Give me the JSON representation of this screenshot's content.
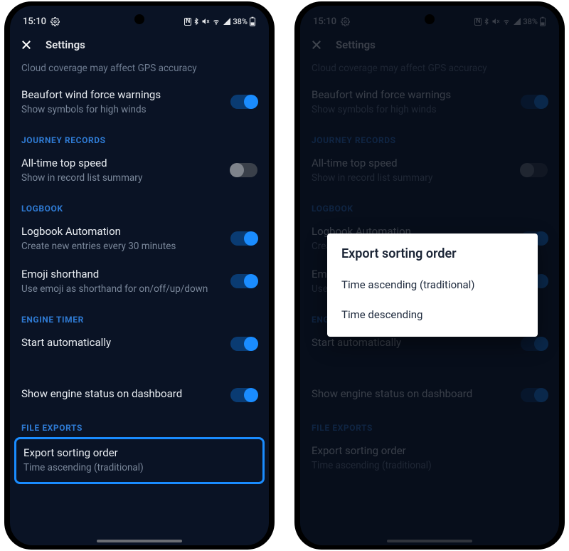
{
  "statusbar": {
    "time": "15:10",
    "battery_pct": "38%"
  },
  "appbar": {
    "title": "Settings"
  },
  "truncated_line": "Cloud coverage may affect GPS accuracy",
  "settings": {
    "beaufort": {
      "title": "Beaufort wind force warnings",
      "sub": "Show symbols for high winds"
    },
    "top_speed": {
      "title": "All-time top speed",
      "sub": "Show in record list summary"
    },
    "logbook_auto": {
      "title": "Logbook Automation",
      "sub": "Create new entries every 30 minutes"
    },
    "emoji": {
      "title": "Emoji shorthand",
      "sub": "Use emoji as shorthand for on/off/up/down"
    },
    "start_auto": {
      "title": "Start automatically",
      "sub": ""
    },
    "engine_dash": {
      "title": "Show engine status on dashboard",
      "sub": ""
    },
    "export_sort": {
      "title": "Export sorting order",
      "sub": "Time ascending (traditional)"
    }
  },
  "sections": {
    "journey": "JOURNEY RECORDS",
    "logbook": "LOGBOOK",
    "engine": "ENGINE TIMER",
    "files": "FILE EXPORTS"
  },
  "dialog": {
    "title": "Export sorting order",
    "opt1": "Time ascending (traditional)",
    "opt2": "Time descending"
  }
}
